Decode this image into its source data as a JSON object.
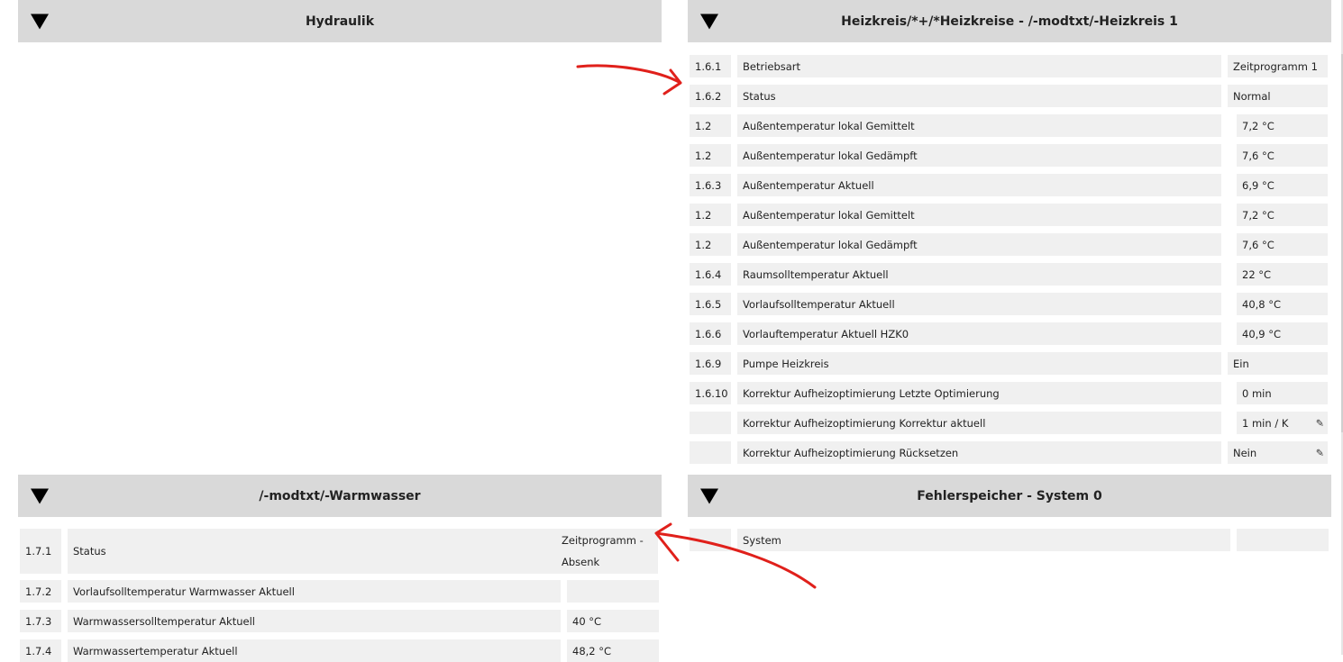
{
  "hydraulik": {
    "title": "Hydraulik"
  },
  "heizkreis": {
    "title": "Heizkreis/*+/*Heizkreise - /-modtxt/-Heizkreis 1",
    "rows": [
      {
        "id": "1.6.1",
        "label": "Betriebsart",
        "value": "Zeitprogramm 1",
        "editable": false
      },
      {
        "id": "1.6.2",
        "label": "Status",
        "value": "Normal",
        "editable": false
      },
      {
        "id": "1.2",
        "label": "Außentemperatur lokal Gemittelt",
        "value": "7,2 °C",
        "editable": false
      },
      {
        "id": "1.2",
        "label": "Außentemperatur lokal Gedämpft",
        "value": "7,6 °C",
        "editable": false
      },
      {
        "id": "1.6.3",
        "label": "Außentemperatur Aktuell",
        "value": "6,9 °C",
        "editable": false
      },
      {
        "id": "1.2",
        "label": "Außentemperatur lokal Gemittelt",
        "value": "7,2 °C",
        "editable": false
      },
      {
        "id": "1.2",
        "label": "Außentemperatur lokal Gedämpft",
        "value": "7,6 °C",
        "editable": false
      },
      {
        "id": "1.6.4",
        "label": "Raumsolltemperatur Aktuell",
        "value": "22 °C",
        "editable": false
      },
      {
        "id": "1.6.5",
        "label": "Vorlaufsolltemperatur Aktuell",
        "value": "40,8 °C",
        "editable": false
      },
      {
        "id": "1.6.6",
        "label": "Vorlauftemperatur Aktuell HZK0",
        "value": "40,9 °C",
        "editable": false
      },
      {
        "id": "1.6.9",
        "label": "Pumpe Heizkreis",
        "value": "Ein",
        "editable": false
      },
      {
        "id": "1.6.10",
        "label": "Korrektur Aufheizoptimierung Letzte Optimierung",
        "value": "0 min",
        "editable": false
      },
      {
        "id": "",
        "label": "Korrektur Aufheizoptimierung Korrektur aktuell",
        "value": "1 min / K",
        "editable": true
      },
      {
        "id": "",
        "label": "Korrektur Aufheizoptimierung Rücksetzen",
        "value": "Nein",
        "editable": true
      }
    ]
  },
  "warmwasser": {
    "title": "/-modtxt/-Warmwasser",
    "rows": [
      {
        "id": "1.7.1",
        "label": "Status",
        "value": "Zeitprogramm - Absenk"
      },
      {
        "id": "1.7.2",
        "label": "Vorlaufsolltemperatur Warmwasser Aktuell",
        "value": ""
      },
      {
        "id": "1.7.3",
        "label": "Warmwassersolltemperatur Aktuell",
        "value": "40 °C"
      },
      {
        "id": "1.7.4",
        "label": "Warmwassertemperatur Aktuell",
        "value": "48,2 °C"
      }
    ]
  },
  "fehlerspeicher": {
    "title": "Fehlerspeicher - System 0",
    "rows": [
      {
        "id": "",
        "label": "System",
        "value": ""
      }
    ]
  },
  "icons": {
    "toggle": "triangle-down-icon",
    "edit": "pencil-icon"
  },
  "colors": {
    "header_bg": "#d9d9d9",
    "cell_bg": "#f0f0f0",
    "annotation": "#e0201b"
  }
}
